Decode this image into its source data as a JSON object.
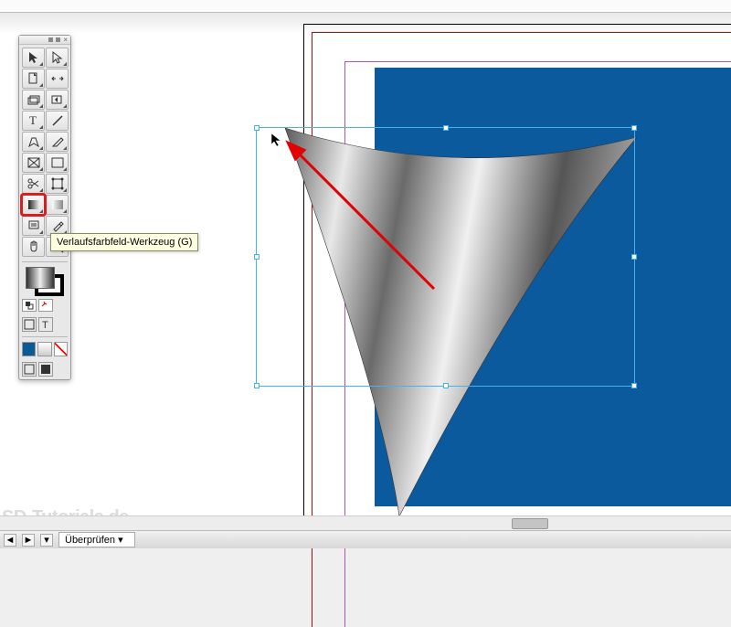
{
  "tooltip": {
    "gradient": "Verlaufsfarbfeld-Werkzeug (G)"
  },
  "bottom_bar": {
    "status": "Überprüfen"
  },
  "watermark": "SD-Tutorials.de",
  "tools": {
    "selection": "Selection",
    "direct": "Direct Select",
    "pen": "Pen",
    "type": "Type",
    "line": "Line",
    "rect": "Rectangle",
    "scissors": "Scissors",
    "gradient": "Gradient",
    "eyedrop": "Eyedropper",
    "hand": "Hand",
    "zoom": "Zoom"
  },
  "colors": {
    "blue": "#0c5a9e",
    "accent": "#d81e1e"
  }
}
